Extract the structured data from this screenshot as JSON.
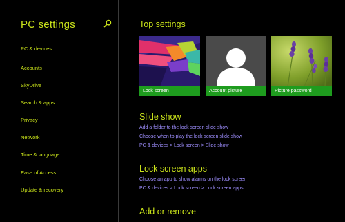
{
  "sidebar": {
    "title": "PC settings",
    "items": [
      {
        "label": "PC & devices"
      },
      {
        "label": "Accounts"
      },
      {
        "label": "SkyDrive"
      },
      {
        "label": "Search & apps"
      },
      {
        "label": "Privacy"
      },
      {
        "label": "Network"
      },
      {
        "label": "Time & language"
      },
      {
        "label": "Ease of Access"
      },
      {
        "label": "Update & recovery"
      }
    ]
  },
  "main": {
    "top_settings": {
      "title": "Top settings",
      "tiles": [
        {
          "label": "Lock screen"
        },
        {
          "label": "Account picture"
        },
        {
          "label": "Picture password"
        }
      ]
    },
    "slide_show": {
      "title": "Slide show",
      "links": [
        "Add a folder to the lock screen slide show",
        "Choose when to play the lock screen slide show",
        "PC & devices > Lock screen > Slide show"
      ]
    },
    "lock_screen_apps": {
      "title": "Lock screen apps",
      "links": [
        "Choose an app to show alarms on the lock screen",
        "PC & devices > Lock screen > Lock screen apps"
      ]
    },
    "add_remove": {
      "title": "Add or remove"
    }
  },
  "colors": {
    "accent": "#c9e21a",
    "link": "#9f8fff",
    "tile_label_bg": "#1e9c1e",
    "background": "#000000"
  },
  "icons": {
    "search": "search-icon"
  }
}
